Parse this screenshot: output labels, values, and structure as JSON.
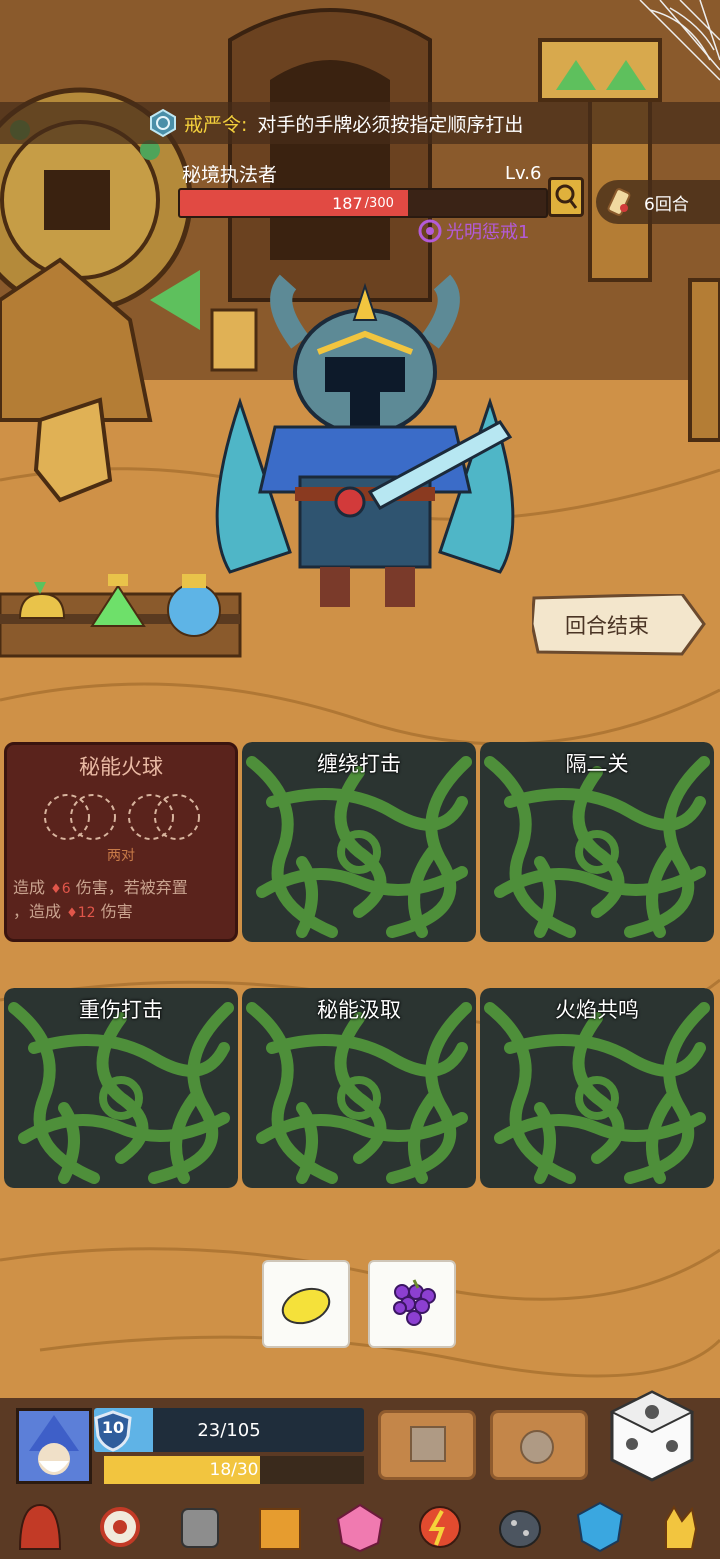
{
  "decree": {
    "label": "戒严令:",
    "text": "对手的手牌必须按指定顺序打出"
  },
  "enemy": {
    "name": "秘境执法者",
    "level": "Lv.6",
    "hp_current": "187",
    "hp_max": " /300",
    "hp_fraction": 0.623,
    "status": "光明惩戒1"
  },
  "turn": {
    "label": "6回合"
  },
  "end_turn_button": "回合结束",
  "cards": [
    {
      "title": "秘能火球",
      "face_up": true,
      "die_req": "两对",
      "text_a": "造成",
      "dmg_a": "6",
      "text_b": "伤害，若被弃置",
      "text_c": "，造成",
      "dmg_b": "12",
      "text_d": "伤害"
    },
    {
      "title": "缠绕打击",
      "face_up": false
    },
    {
      "title": "隔二关",
      "face_up": false
    },
    {
      "title": "重伤打击",
      "face_up": false
    },
    {
      "title": "秘能汲取",
      "face_up": false
    },
    {
      "title": "火焰共鸣",
      "face_up": false
    }
  ],
  "dice_tiles": [
    {
      "icon": "lemon-icon"
    },
    {
      "icon": "grape-icon"
    }
  ],
  "player": {
    "level": "10",
    "hp_text": "23/105",
    "hp_fraction": 0.219,
    "energy_text": "18/30",
    "energy_fraction": 0.6
  },
  "colors": {
    "hp_red": "#e14a43",
    "player_hp": "#5fb3e6",
    "energy": "#f2c53f",
    "status_purple": "#b35bd7",
    "decree_yellow": "#f2cf3c"
  },
  "relics": [
    "red-hood-icon",
    "flaming-eye-icon",
    "iron-pot-icon",
    "sweater-icon",
    "crystal-die-icon",
    "lightning-orb-icon",
    "spotted-stone-icon",
    "blue-shield-gem-icon",
    "glove-icon"
  ]
}
